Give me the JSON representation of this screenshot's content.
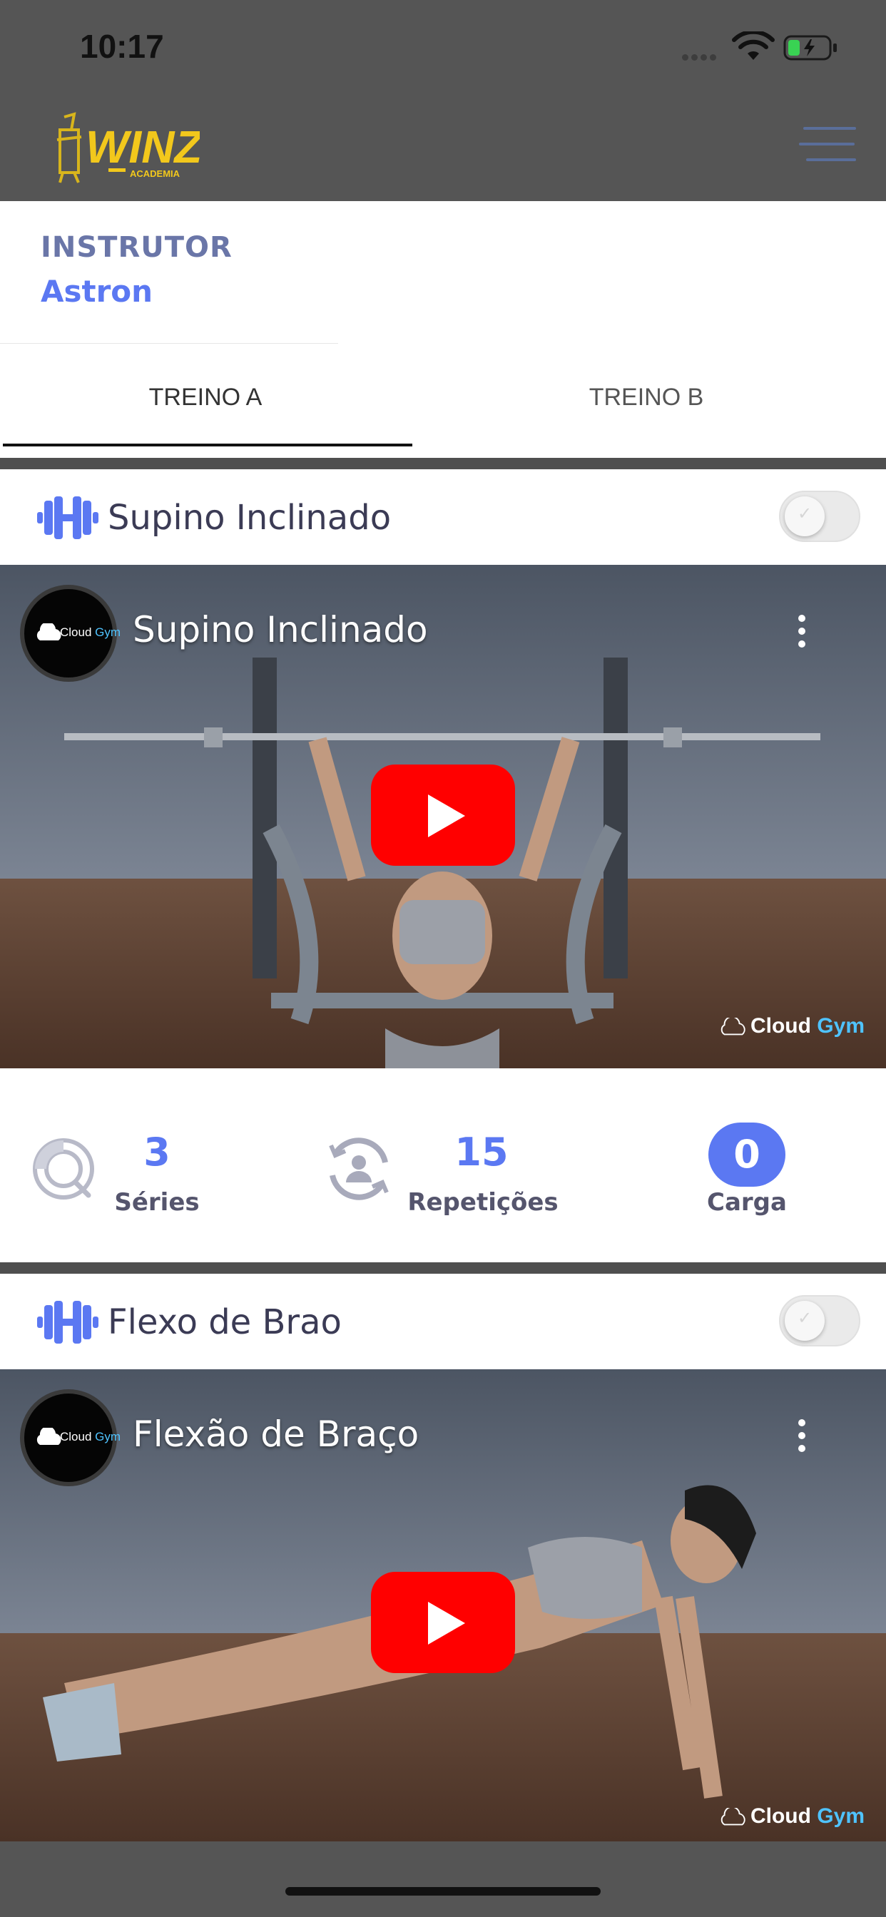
{
  "status_bar": {
    "time": "10:17"
  },
  "header": {
    "logo_text": "WINZ",
    "logo_subtext": "ACADEMIA",
    "menu_icon": "hamburger-icon"
  },
  "instructor": {
    "label": "INSTRUTOR",
    "name": "Astron"
  },
  "tabs": [
    {
      "label": "TREINO A",
      "active": true
    },
    {
      "label": "TREINO B",
      "active": false
    }
  ],
  "exercises": [
    {
      "title": "Supino Inclinado",
      "completed": false,
      "video": {
        "channel": "Cloud",
        "channel_accent": "Gym",
        "title": "Supino Inclinado",
        "watermark": "Cloud",
        "watermark_accent": "Gym"
      },
      "stats": {
        "series_value": "3",
        "series_label": "Séries",
        "reps_value": "15",
        "reps_label": "Repetições",
        "carga_value": "0",
        "carga_label": "Carga"
      }
    },
    {
      "title": "Flexo de Brao",
      "completed": false,
      "video": {
        "channel": "Cloud",
        "channel_accent": "Gym",
        "title": "Flexão de Braço",
        "watermark": "Cloud",
        "watermark_accent": "Gym"
      }
    }
  ],
  "colors": {
    "accent": "#5b78f2",
    "bar": "#555555",
    "play_red": "#ff0000",
    "logo_yellow": "#f2c81c"
  }
}
